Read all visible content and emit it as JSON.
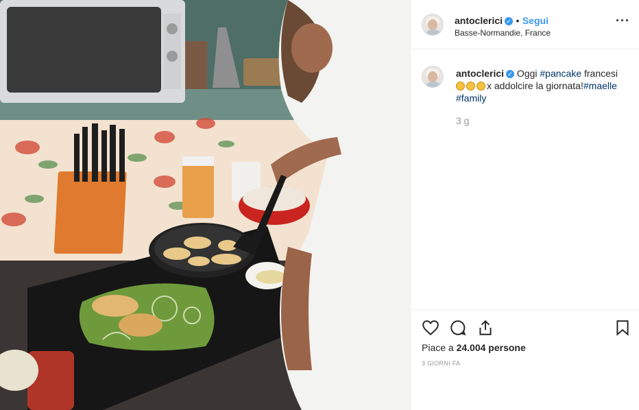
{
  "post": {
    "username": "antoclerici",
    "follow_label": "Segui",
    "location": "Basse-Normandie, France",
    "more_icon": "···"
  },
  "caption": {
    "username": "antoclerici",
    "text_before_tag": "Oggi ",
    "tag1": "#pancake",
    "text_after_tag1": " francesi",
    "emoji_count": 3,
    "text_after_emoji": "x addolcire la giornata!",
    "tag2": "#maelle",
    "tag3": "#family",
    "time_ago": "3 g"
  },
  "actions": {
    "like_icon": "heart-icon",
    "comment_icon": "comment-icon",
    "share_icon": "share-icon",
    "save_icon": "bookmark-icon"
  },
  "likes_label_prefix": "Piace a ",
  "likes_count": "24.004",
  "likes_label_suffix": " persone",
  "date_label": "3 GIORNI FA",
  "colors": {
    "link_blue": "#3897f0",
    "hashtag": "#003569",
    "muted": "#999999"
  }
}
